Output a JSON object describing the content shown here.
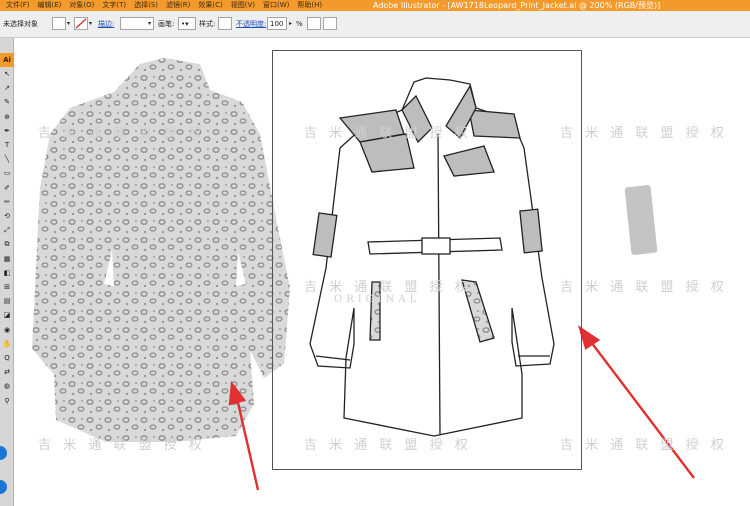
{
  "window": {
    "title": "Adobe Illustrator - [AW1718Leopard_Print_Jacket.ai @ 200% (RGB/预览)]",
    "menus": [
      "文件(F)",
      "编辑(E)",
      "对象(O)",
      "文字(T)",
      "选择(S)",
      "滤镜(R)",
      "效果(C)",
      "视图(V)",
      "窗口(W)",
      "帮助(H)"
    ]
  },
  "controlbar": {
    "selection_status": "未选择对象",
    "stroke_label": "描边:",
    "brush_label": "画笔:",
    "style_label": "样式:",
    "opacity_label": "不透明度:",
    "opacity_value": "100",
    "opacity_unit": "%"
  },
  "toolbar": {
    "logo": "Ai",
    "tools": [
      "↖",
      "↗",
      "✎",
      "⊕",
      "✒",
      "T",
      "╲",
      "▭",
      "✐",
      "✏",
      "⟲",
      "⤢",
      "⧉",
      "▦",
      "◧",
      "⊞",
      "▤",
      "◪",
      "◉",
      "✋",
      "Q",
      "⇄",
      "◍",
      "⚲"
    ]
  },
  "watermarks": {
    "text_a": "吉 米 通 联 盟 授 权",
    "text_b": "ORIGINAL"
  },
  "colors": {
    "titlebar": "#f39a2c",
    "arrow": "#e03030",
    "jacket_fill": "#d8d8d8",
    "jacket_grey": "#bdbdbd",
    "leopard_spot": "#8a8a8a"
  }
}
